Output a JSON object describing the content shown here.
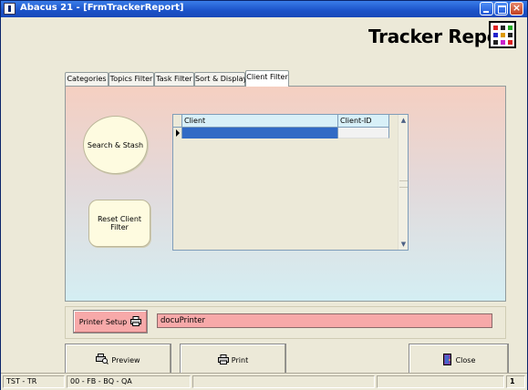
{
  "window": {
    "title": "Abacus 21 - [FrmTrackerReport]",
    "controls": [
      "minimize",
      "maximize",
      "close"
    ],
    "close_glyph": "×"
  },
  "header": {
    "report_title": "Tracker Report",
    "logo_icon": "tracker-logo-icon"
  },
  "tabs": [
    {
      "label": "Categories",
      "active": false
    },
    {
      "label": "Topics Filter",
      "active": false
    },
    {
      "label": "Task Filter",
      "active": false
    },
    {
      "label": "Sort & Display",
      "active": false
    },
    {
      "label": "Client Filter",
      "active": true
    }
  ],
  "client_filter": {
    "search_button": "Search & Stash",
    "reset_button": "Reset Client Filter",
    "grid": {
      "columns": [
        "Client",
        "Client-ID"
      ],
      "rows": [
        {
          "client": "",
          "client_id": ""
        }
      ]
    }
  },
  "printer": {
    "setup_button": "Printer Setup",
    "printer_name": "docuPrinter"
  },
  "actions": {
    "preview": "Preview",
    "print": "Print",
    "close": "Close"
  },
  "statusbar": {
    "pane1": "TST - TR",
    "pane2": "00 - FB - BQ - QA",
    "pane3": "",
    "pane4": "",
    "pane5": "1"
  },
  "colors": {
    "titlebar": "#1b52c8",
    "printer_pink": "#f7a9a9",
    "selection": "#316ac5",
    "panel_top": "#f5cfc1",
    "panel_bottom": "#d4eef3"
  }
}
